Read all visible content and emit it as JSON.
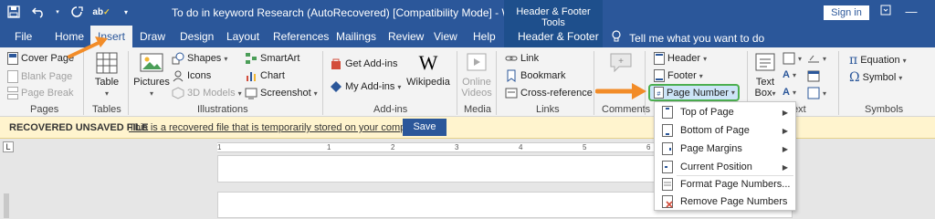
{
  "titlebar": {
    "document_title": "To do in keyword Research (AutoRecovered) [Compatibility Mode]  -  Word",
    "contextual_tools": "Header & Footer Tools",
    "sign_in": "Sign in",
    "qat_icons": [
      "save-icon",
      "undo-icon",
      "redo-icon",
      "spelling-icon",
      "customize-qat-icon"
    ]
  },
  "tabs": [
    {
      "label": "File"
    },
    {
      "label": "Home"
    },
    {
      "label": "Insert"
    },
    {
      "label": "Draw"
    },
    {
      "label": "Design"
    },
    {
      "label": "Layout"
    },
    {
      "label": "References"
    },
    {
      "label": "Mailings"
    },
    {
      "label": "Review"
    },
    {
      "label": "View"
    },
    {
      "label": "Help"
    },
    {
      "label": "Header & Footer"
    }
  ],
  "tell_me": "Tell me what you want to do",
  "ribbon": {
    "pages": {
      "label": "Pages",
      "cover_page": "Cover Page",
      "blank_page": "Blank Page",
      "page_break": "Page Break"
    },
    "tables": {
      "label": "Tables",
      "table": "Table"
    },
    "illustrations": {
      "label": "Illustrations",
      "pictures": "Pictures",
      "shapes": "Shapes",
      "icons": "Icons",
      "models_3d": "3D Models",
      "smartart": "SmartArt",
      "chart": "Chart",
      "screenshot": "Screenshot"
    },
    "addins": {
      "label": "Add-ins",
      "get_addins": "Get Add-ins",
      "my_addins": "My Add-ins",
      "wikipedia": "Wikipedia"
    },
    "media": {
      "label": "Media",
      "online_videos_1": "Online",
      "online_videos_2": "Videos"
    },
    "links": {
      "label": "Links",
      "link": "Link",
      "bookmark": "Bookmark",
      "cross_reference": "Cross-reference"
    },
    "comments": {
      "label": "Comments"
    },
    "header_footer": {
      "header": "Header",
      "footer": "Footer",
      "page_number": "Page Number"
    },
    "text": {
      "label": "Text",
      "label_partial": "ext",
      "text_box_1": "Text",
      "text_box_2": "Box"
    },
    "symbols": {
      "label": "Symbols",
      "equation": "Equation",
      "symbol": "Symbol"
    }
  },
  "notification": {
    "title": "RECOVERED UNSAVED FILE",
    "message": "This is a recovered file that is temporarily stored on your computer.",
    "save": "Save"
  },
  "ruler": {
    "corner": "L",
    "numbers": [
      "1",
      "1",
      "2",
      "3",
      "4",
      "5",
      "6"
    ]
  },
  "page_number_menu": {
    "items": [
      {
        "label": "Top of Page",
        "icon": "page-top-icon",
        "submenu": true
      },
      {
        "label": "Bottom of Page",
        "icon": "page-bottom-icon",
        "submenu": true
      },
      {
        "label": "Page Margins",
        "icon": "page-margins-icon",
        "submenu": true
      },
      {
        "label": "Current Position",
        "icon": "current-position-icon",
        "submenu": true
      },
      {
        "label": "Format Page Numbers...",
        "icon": "format-page-numbers-icon",
        "submenu": false
      },
      {
        "label": "Remove Page Numbers",
        "icon": "remove-page-numbers-icon",
        "submenu": false
      }
    ]
  },
  "colors": {
    "title_bar": "#2b579a",
    "contextual": "#1e4f8c",
    "ribbon": "#f3f3f3",
    "notification": "#fff4ce",
    "highlight": "#4caf50",
    "annotation_arrow": "#f28c28"
  }
}
